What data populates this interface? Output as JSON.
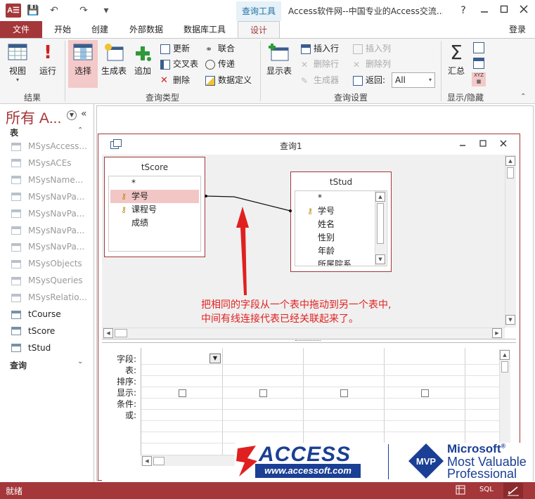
{
  "app": {
    "icon_text": "A☰",
    "window_title": "Access软件网--中国专业的Access交流...",
    "context_tab": "查询工具",
    "login": "登录",
    "help": "?",
    "quick_access": [
      "💾",
      "↶",
      "↷",
      "▾"
    ]
  },
  "tabs": {
    "file": "文件",
    "items": [
      "开始",
      "创建",
      "外部数据",
      "数据库工具"
    ],
    "active": "设计"
  },
  "ribbon": {
    "results": {
      "label": "结果",
      "view": "视图",
      "run": "运行"
    },
    "query_type": {
      "label": "查询类型",
      "select": "选择",
      "make_table": "生成表",
      "append": "追加",
      "update": "更新",
      "crosstab": "交叉表",
      "delete": "删除",
      "union": "联合",
      "pass_through": "传递",
      "data_definition": "数据定义"
    },
    "query_setup": {
      "label": "查询设置",
      "show_table": "显示表",
      "insert_rows": "插入行",
      "delete_rows": "删除行",
      "builder": "生成器",
      "insert_columns": "插入列",
      "delete_columns": "删除列",
      "return_label": "返回:",
      "return_value": "All"
    },
    "show_hide": {
      "label": "显示/隐藏",
      "totals": "汇总"
    }
  },
  "nav": {
    "title": "所有 A...",
    "group_tables": "表",
    "group_queries": "查询",
    "tables": [
      {
        "name": "MSysAccess...",
        "system": true
      },
      {
        "name": "MSysACEs",
        "system": true
      },
      {
        "name": "MSysName...",
        "system": true
      },
      {
        "name": "MSysNavPa...",
        "system": true
      },
      {
        "name": "MSysNavPa...",
        "system": true
      },
      {
        "name": "MSysNavPa...",
        "system": true
      },
      {
        "name": "MSysNavPa...",
        "system": true
      },
      {
        "name": "MSysObjects",
        "system": true
      },
      {
        "name": "MSysQueries",
        "system": true
      },
      {
        "name": "MSysRelatio...",
        "system": true
      },
      {
        "name": "tCourse",
        "system": false
      },
      {
        "name": "tScore",
        "system": false
      },
      {
        "name": "tStud",
        "system": false
      }
    ]
  },
  "query": {
    "title": "查询1",
    "tscore": {
      "name": "tScore",
      "fields": [
        "*",
        "学号",
        "课程号",
        "成绩"
      ]
    },
    "tstud": {
      "name": "tStud",
      "fields": [
        "*",
        "学号",
        "姓名",
        "性别",
        "年龄",
        "所属院系"
      ]
    },
    "grid_rows": [
      "字段:",
      "表:",
      "排序:",
      "显示:",
      "条件:",
      "或:"
    ]
  },
  "annotation": {
    "line1": "把相同的字段从一个表中拖动到另一个表中,",
    "line2": "中间有线连接代表已经关联起来了。"
  },
  "logo": {
    "access": "ACCESS",
    "url": "www.accessoft.com",
    "mvp": "MVP",
    "line1": "Microsoft",
    "line2": "Most Valuable",
    "line3": "Professional"
  },
  "status": {
    "text": "就绪",
    "sql": "SQL"
  },
  "colors": {
    "brand": "#a4373a",
    "annotation": "#e02020",
    "logo_blue": "#1a3f94"
  }
}
